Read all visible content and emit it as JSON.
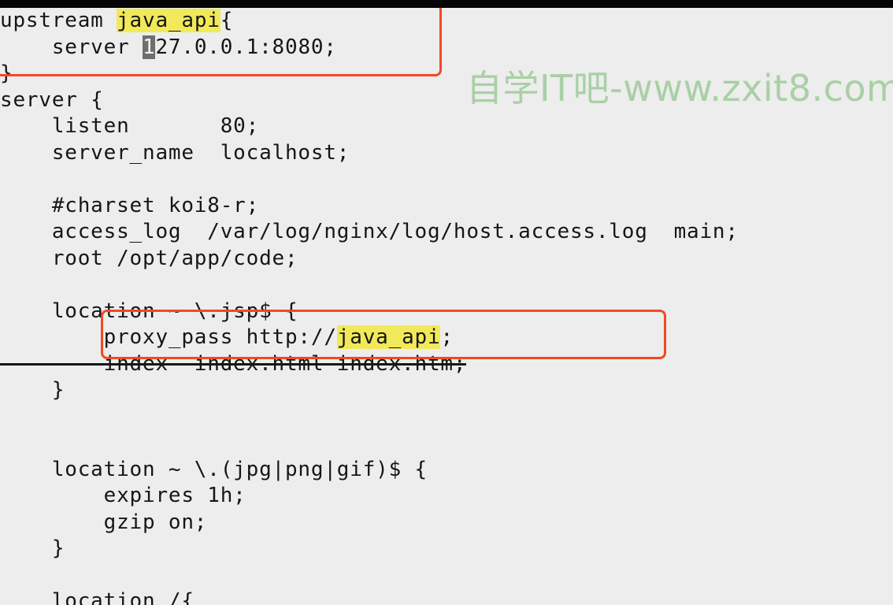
{
  "watermark": "自学IT吧-www.zxit8.com",
  "code": {
    "upstream": {
      "keyword": "upstream ",
      "name": "java_api",
      "open": "{",
      "server_indent": "    server ",
      "server_cursor_char": "1",
      "server_rest": "27.0.0.1:8080;",
      "close": "}"
    },
    "lines": [
      "server {",
      "    listen       80;",
      "    server_name  localhost;",
      "",
      "    #charset koi8-r;",
      "    access_log  /var/log/nginx/log/host.access.log  main;",
      "    root /opt/app/code;",
      "",
      "    location ~ \\.jsp$ {"
    ],
    "proxy": {
      "indent": "        proxy_pass http://",
      "target": "java_api",
      "end": ";"
    },
    "index_line": "        index  index.html index.htm;",
    "tail_lines": [
      "    }",
      "",
      "",
      "    location ~ \\.(jpg|png|gif)$ {",
      "        expires 1h;",
      "        gzip on;",
      "    }",
      "",
      "    location /{"
    ]
  }
}
